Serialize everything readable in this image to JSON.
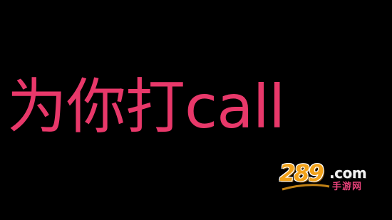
{
  "headline": {
    "text": "为你打call",
    "color": "#E8386A"
  },
  "watermark": {
    "number": "289",
    "domain": ".com",
    "subtitle": "手游网",
    "logo_color": "#F2A21A",
    "subtitle_color": "#E9417A"
  },
  "background_color": "#000000"
}
